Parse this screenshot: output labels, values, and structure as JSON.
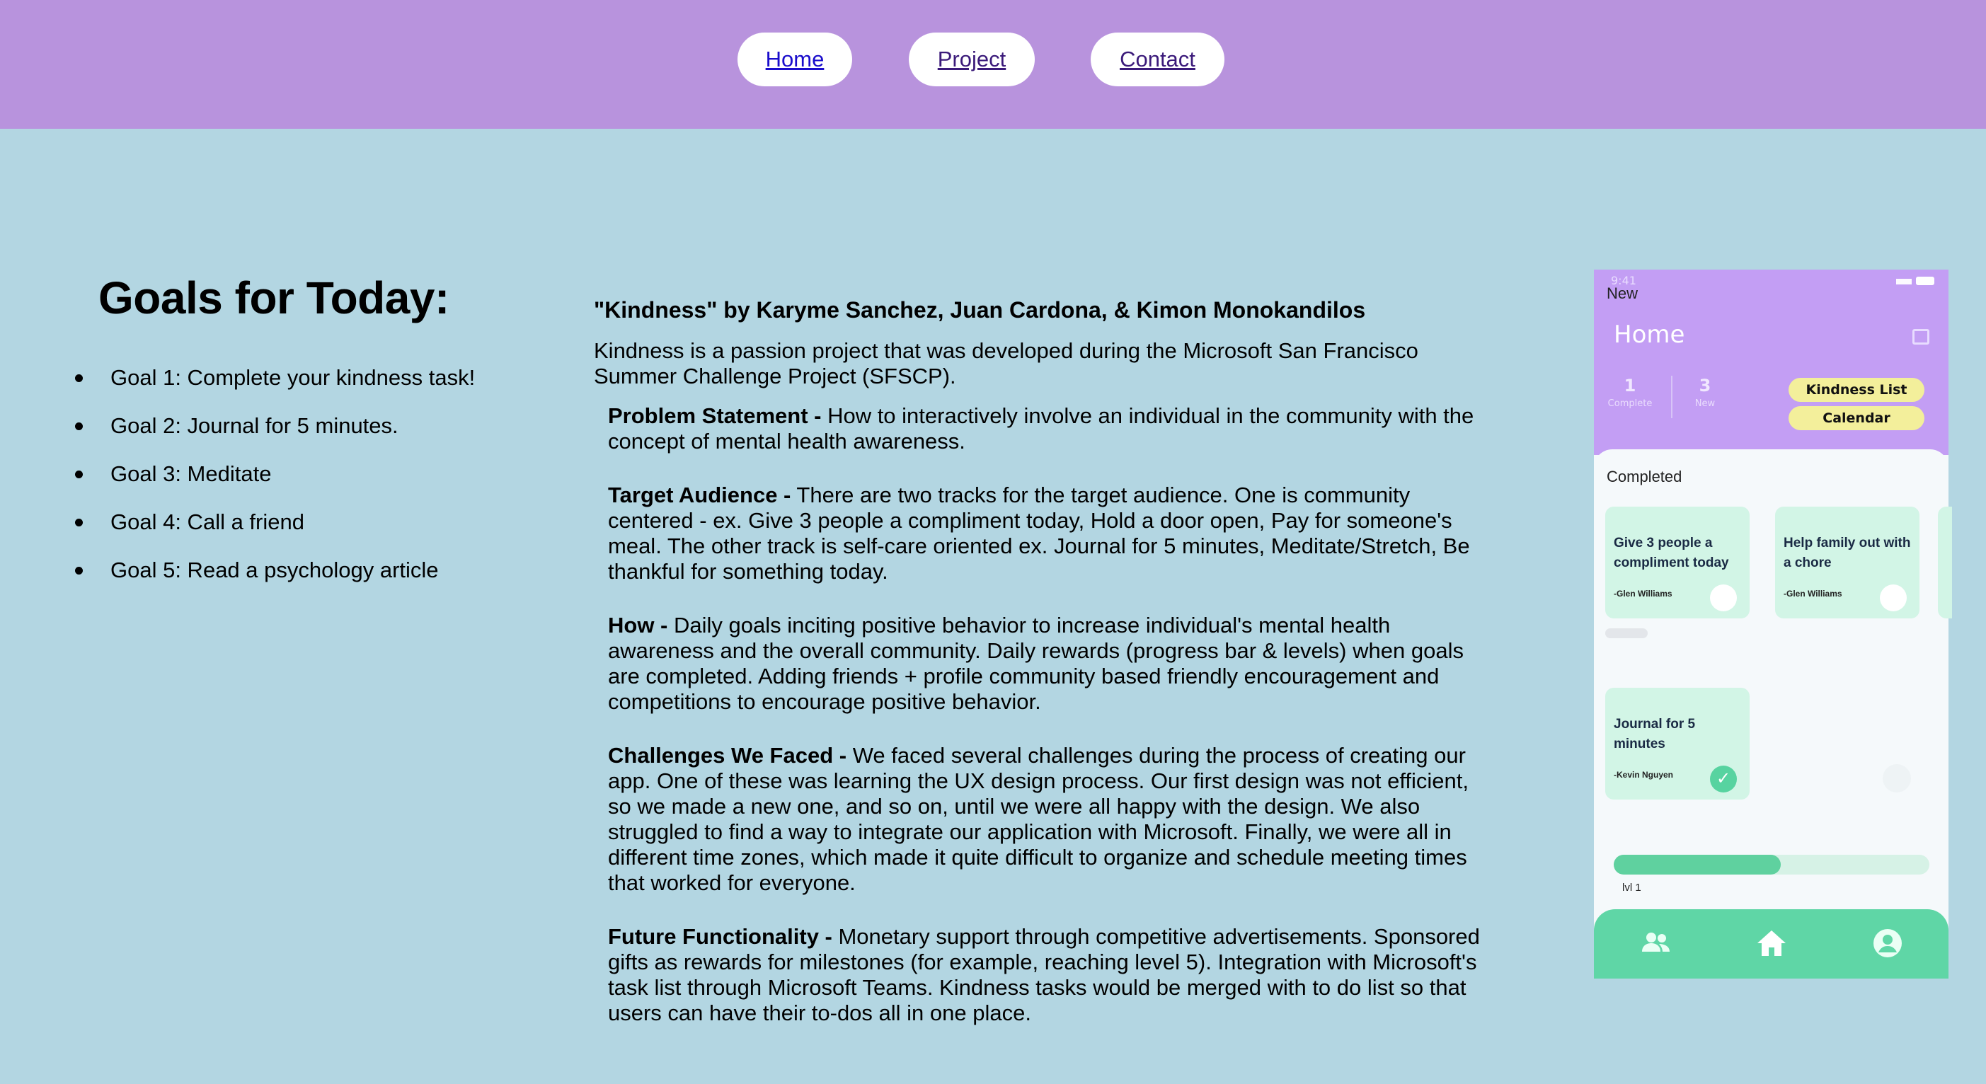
{
  "nav": {
    "home": "Home",
    "project": "Project",
    "contact": "Contact"
  },
  "goals": {
    "title": "Goals for Today:",
    "items": [
      "Goal 1: Complete your kindness task!",
      "Goal 2: Journal for 5 minutes.",
      "Goal 3: Meditate",
      "Goal 4: Call a friend",
      "Goal 5: Read a psychology article"
    ]
  },
  "project": {
    "title": "\"Kindness\" by Karyme Sanchez, Juan Cardona, & Kimon Monokandilos",
    "intro": "Kindness is a passion project that was developed during the Microsoft San Francisco Summer Challenge Project (SFSCP).",
    "sections": [
      {
        "heading": "Problem Statement -",
        "body": " How to interactively involve an individual in the community with the concept of mental health awareness."
      },
      {
        "heading": "Target Audience -",
        "body": " There are two tracks for the target audience. One is community centered - ex. Give 3 people a compliment today, Hold a door open, Pay for someone's meal. The other track is self-care oriented ex. Journal for 5 minutes, Meditate/Stretch, Be thankful for something today."
      },
      {
        "heading": "How -",
        "body": " Daily goals inciting positive behavior to increase individual's mental health awareness and the overall community. Daily rewards (progress bar & levels) when goals are completed. Adding friends + profile community based friendly encouragement and competitions to encourage positive behavior."
      },
      {
        "heading": "Challenges We Faced -",
        "body": " We faced several challenges during the process of creating our app. One of these was learning the UX design process. Our first design was not efficient, so we made a new one, and so on, until we were all happy with the design. We also struggled to find a way to integrate our application with Microsoft. Finally, we were all in different time zones, which made it quite difficult to organize and schedule meeting times that worked for everyone."
      },
      {
        "heading": "Future Functionality -",
        "body": " Monetary support through competitive advertisements. Sponsored gifts as rewards for milestones (for example, reaching level 5). Integration with Microsoft's task list through Microsoft Teams. Kindness tasks would be merged with to do list so that users can have their to-dos all in one place."
      }
    ]
  },
  "phone": {
    "time": "9:41",
    "title": "Home",
    "stats": [
      {
        "num": "1",
        "label": "Complete"
      },
      {
        "num": "3",
        "label": "New"
      }
    ],
    "kindness_list": "Kindness List",
    "calendar": "Calendar",
    "new_label": "New",
    "completed_label": "Completed",
    "new_cards": [
      {
        "text": "Give 3 people a compliment today",
        "by": "-Glen Williams"
      },
      {
        "text": "Help family out with a chore",
        "by": "-Glen Williams"
      }
    ],
    "completed_cards": [
      {
        "text": "Journal for 5 minutes",
        "by": "-Kevin Nguyen"
      }
    ],
    "progress_fraction": 0.53,
    "level": "lvl 1",
    "colors": {
      "header": "#c39ef4",
      "accent_green": "#5fd19f",
      "pill_yellow": "#f3ef9b"
    },
    "icons": [
      "friends-icon",
      "home-icon",
      "profile-icon",
      "calendar-icon",
      "check-icon"
    ]
  }
}
